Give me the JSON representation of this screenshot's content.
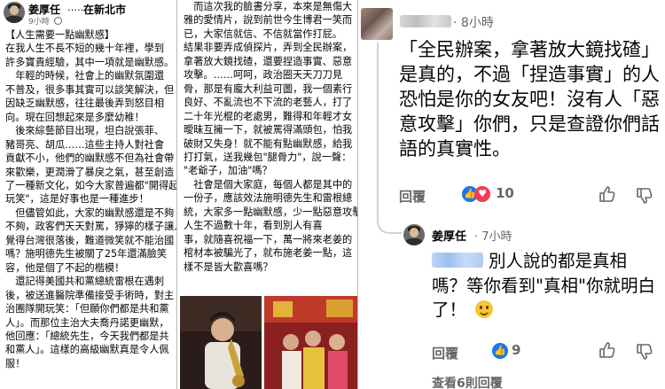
{
  "post": {
    "author": "姜厚任",
    "separator": "……",
    "location": "在新北市",
    "time": "9小時",
    "lines_col1": [
      "【人生需要一點幽默感】",
      "在我人生不長不短的幾十年裡，學到",
      "許多寶貴經驗，其中一項就是幽默感。",
      "　年輕的時候，社會上的幽默氛圍還",
      "不普及，很多事其實可以談笑解決，但",
      "因缺乏幽默感，往往最後弄到怒目相",
      "向。現在回想起來是多麼幼稚！",
      "　後來綜藝節目出現，坦白說張菲、",
      "豬哥亮、胡瓜……這些主持人對社會",
      "貢獻不小，他們的幽默感不但為社會帶",
      "來歡樂，更潤滑了暴戾之氣，甚至創造",
      "了一種新文化，如今大家普遍都\"開得起",
      "玩笑\"，這是好事也是一種進步！",
      "　但儘管如此，大家的幽默感還是不夠",
      "不夠，政客們天天對罵，猙獰的樣子讓人",
      "覺得台灣很落後，難道微笑就不能治國",
      "嗎？施明德先生被關了25年還滿臉笑",
      "容，他是個了不起的楷模！",
      "　還記得美國共和黨總統雷根在遇刺",
      "後，被送進醫院準備接受手術時，對主",
      "治團隊開玩笑：「但願你們都是共和黨",
      "人」。而那位主治大夫喬丹諾更幽默，",
      "他回應：「總統先生，今天我們都是共",
      "和黨人」。這樣的高級幽默真是令人佩",
      "服！"
    ],
    "lines_col2": [
      "　而這次我的臉書分享，本來是無傷大",
      "雅的愛情片，說到前世今生博君一笑而",
      "已，大家信就信、不信就當作打屁。",
      "結果非要弄成偵探片，弄到全民辦案，",
      "拿著放大鏡找碴，還要捏造事實、惡意",
      "攻擊。……呵呵，政治圈天天刀刀見",
      "骨，那是有龐大利益可圖，我一個素行",
      "良好、不亂流也不下流的老藝人，打了",
      "二十年光棍的老處男，難得和年輕才女",
      "曖昧互擁一下，就被罵得滿頭包，怕我",
      "破財又失身！就不能有點幽默感，給我",
      "打打氣，送我幾包\"腿骨力\"，說一聲：",
      "\"老爺子，加油\"嗎？",
      "　社會是個大家庭，每個人都是其中的",
      "一份子，應該效法施明德先生和雷根總",
      "統，大家多一點幽默感，少一點惡意攻擊，",
      "人生不過數十年，看到別人有喜",
      "事，就隨喜祝福一下，萬一將來老姜的",
      "棺材本被騙光了，就布施老姜一點，這",
      "樣不是皆大歡喜嗎？"
    ]
  },
  "comment": {
    "author_blurred": "",
    "time": "8小時",
    "lines": [
      "「全民辦案，拿著放大鏡找碴」",
      "是真的，不過「捏造事實」的人",
      "恐怕是你的女友吧！沒有人「惡",
      "意攻擊」你們，只是查證你們話",
      "語的真實性。"
    ],
    "reply_label": "回覆",
    "reaction_count": "10"
  },
  "reply": {
    "author": "姜厚任",
    "time": "7小時",
    "lines": [
      "別人說的都是真相",
      "嗎？等你看到\"真相\"你就明白",
      "了！"
    ],
    "reply_label": "回覆",
    "reaction_count": "9",
    "more_replies": "查看6則回覆"
  },
  "colors": {
    "like_blue": "#1877f2",
    "love_red": "#f33e58",
    "meta_gray": "#65676b"
  }
}
